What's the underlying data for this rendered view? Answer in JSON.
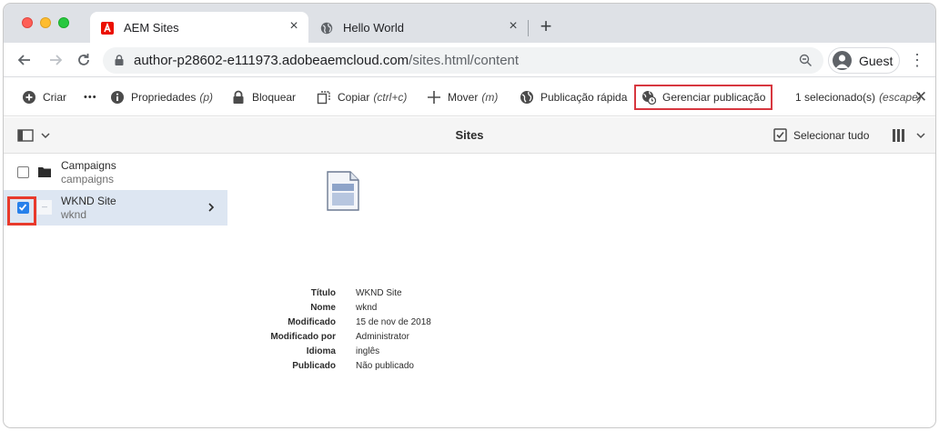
{
  "browser": {
    "tabs": [
      {
        "title": "AEM Sites",
        "favicon": "adobe-icon",
        "active": true
      },
      {
        "title": "Hello World",
        "favicon": "globe-icon",
        "active": false
      }
    ],
    "url_host": "author-p28602-e111973.adobeaemcloud.com",
    "url_path": "/sites.html/content",
    "profile_label": "Guest"
  },
  "actionbar": {
    "create": "Criar",
    "more": "•••",
    "properties": "Propriedades",
    "properties_shortcut": "(p)",
    "lock": "Bloquear",
    "copy": "Copiar",
    "copy_shortcut": "(ctrl+c)",
    "move": "Mover",
    "move_shortcut": "(m)",
    "quick_publish": "Publicação rápida",
    "manage_publication": "Gerenciar publicação",
    "selected_count": "1 selecionado(s)",
    "selected_escape": "(escape)"
  },
  "sitesbar": {
    "title": "Sites",
    "select_all": "Selecionar tudo"
  },
  "column_items": [
    {
      "title": "Campaigns",
      "name": "campaigns",
      "selected": false,
      "icon": "folder-icon"
    },
    {
      "title": "WKND Site",
      "name": "wknd",
      "selected": true,
      "icon": "page-thumbnail-icon"
    }
  ],
  "preview": {
    "fields": [
      {
        "label": "Título",
        "value": "WKND Site"
      },
      {
        "label": "Nome",
        "value": "wknd"
      },
      {
        "label": "Modificado",
        "value": "15 de nov de 2018"
      },
      {
        "label": "Modificado por",
        "value": "Administrator"
      },
      {
        "label": "Idioma",
        "value": "inglês"
      },
      {
        "label": "Publicado",
        "value": "Não publicado"
      }
    ]
  },
  "colors": {
    "highlight_red": "#d7373f",
    "checkbox_blue": "#2680eb",
    "selected_row": "#dde6f2"
  }
}
